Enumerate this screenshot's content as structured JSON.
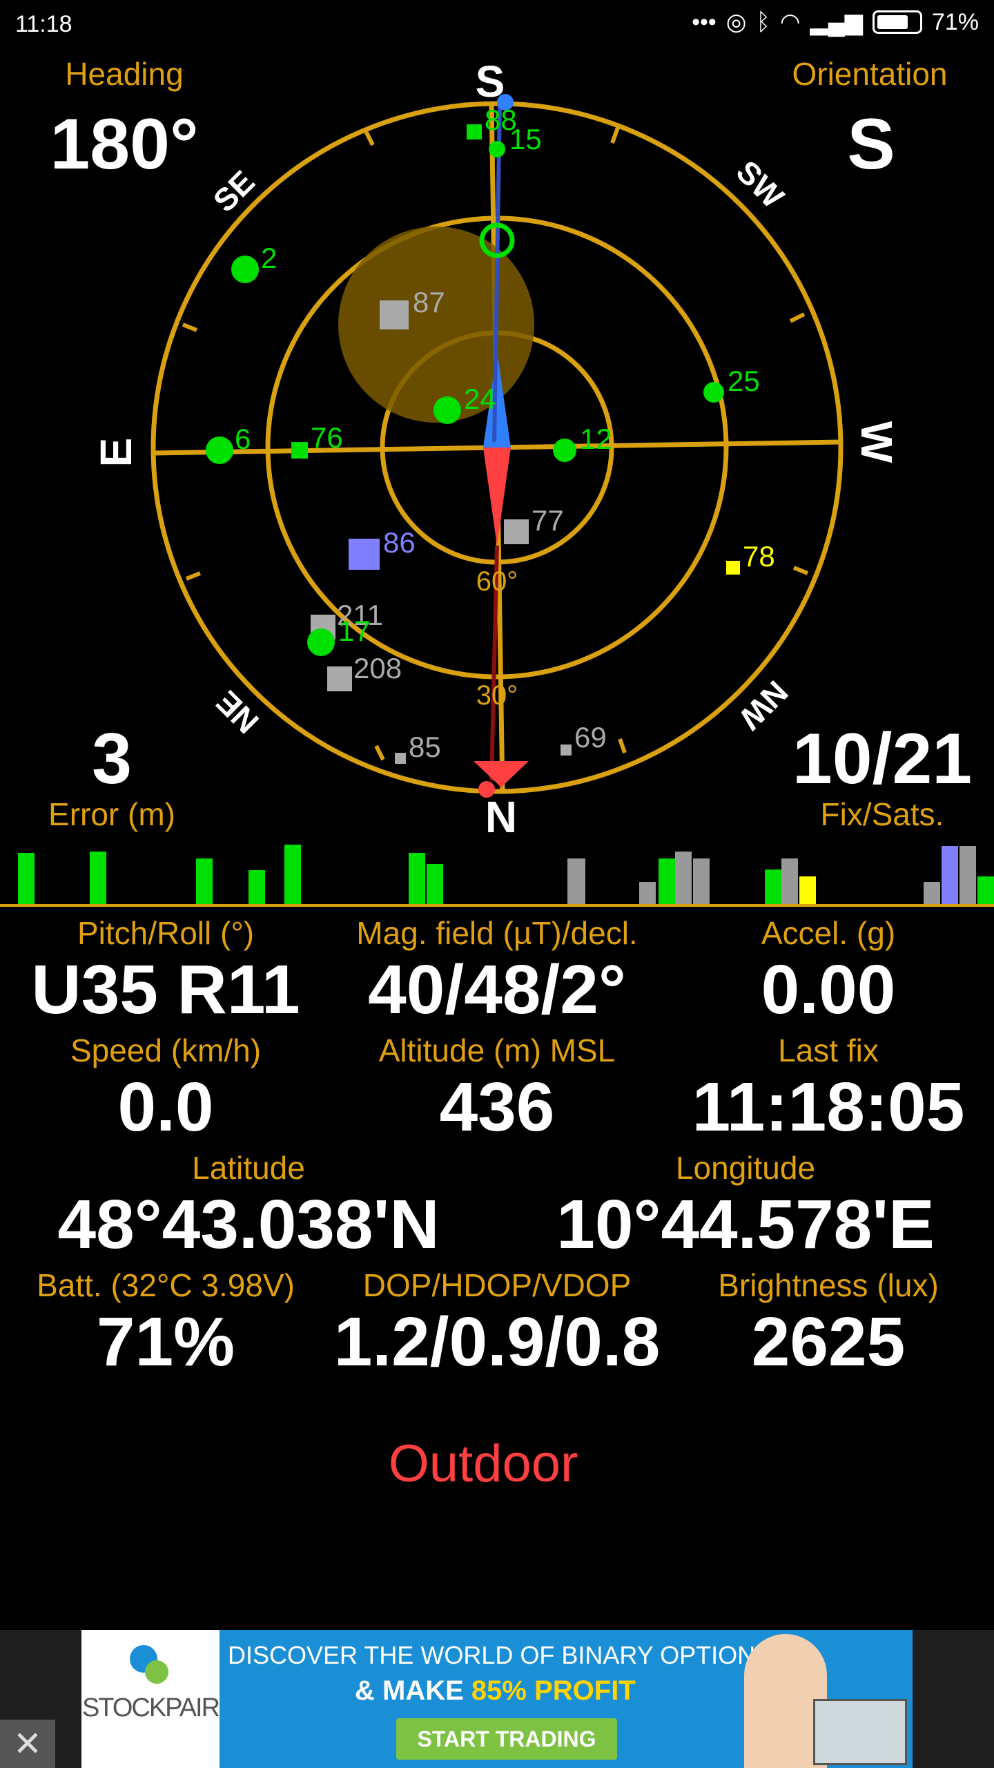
{
  "status_bar": {
    "time": "11:18",
    "battery": "71%"
  },
  "compass": {
    "directions": {
      "s": "S",
      "n": "N",
      "e": "E",
      "w": "W",
      "se": "SE",
      "sw": "SW",
      "ne": "NE",
      "nw": "NW"
    },
    "elevation_labels": [
      "60°",
      "30°"
    ],
    "satellites": [
      "88",
      "15",
      "2",
      "87",
      "24",
      "25",
      "6",
      "76",
      "12",
      "77",
      "86",
      "78",
      "211",
      "17",
      "208",
      "85",
      "69"
    ]
  },
  "heading": {
    "label": "Heading",
    "value": "180°"
  },
  "orientation": {
    "label": "Orientation",
    "value": "S"
  },
  "error": {
    "label": "Error (m)",
    "value": "3"
  },
  "fix": {
    "label": "Fix/Sats.",
    "value": "10/21"
  },
  "stats": {
    "pitch_roll": {
      "label": "Pitch/Roll (°)",
      "value": "U35 R11"
    },
    "mag_field": {
      "label": "Mag. field (µT)/decl.",
      "value": "40/48/2°"
    },
    "accel": {
      "label": "Accel. (g)",
      "value": "0.00"
    },
    "speed": {
      "label": "Speed (km/h)",
      "value": "0.0"
    },
    "altitude": {
      "label": "Altitude (m) MSL",
      "value": "436"
    },
    "last_fix": {
      "label": "Last fix",
      "value": "11:18:05"
    },
    "latitude": {
      "label": "Latitude",
      "value": "48°43.038'N"
    },
    "longitude": {
      "label": "Longitude",
      "value": "10°44.578'E"
    },
    "battery": {
      "label": "Batt. (32°C 3.98V)",
      "value": "71%"
    },
    "dop": {
      "label": "DOP/HDOP/VDOP",
      "value": "1.2/0.9/0.8"
    },
    "brightness": {
      "label": "Brightness (lux)",
      "value": "2625"
    }
  },
  "environment": "Outdoor",
  "ad": {
    "brand": "STOCKPAIR",
    "line1": "DISCOVER THE WORLD OF BINARY OPTIONS!",
    "line2_prefix": "& MAKE",
    "line2_highlight": "85% PROFIT",
    "cta": "START TRADING",
    "close": "✕"
  },
  "colors": {
    "accent": "#e0a010",
    "green": "#00e000",
    "gray": "#999999",
    "red": "#ff4040",
    "blue": "#2f7fff"
  }
}
